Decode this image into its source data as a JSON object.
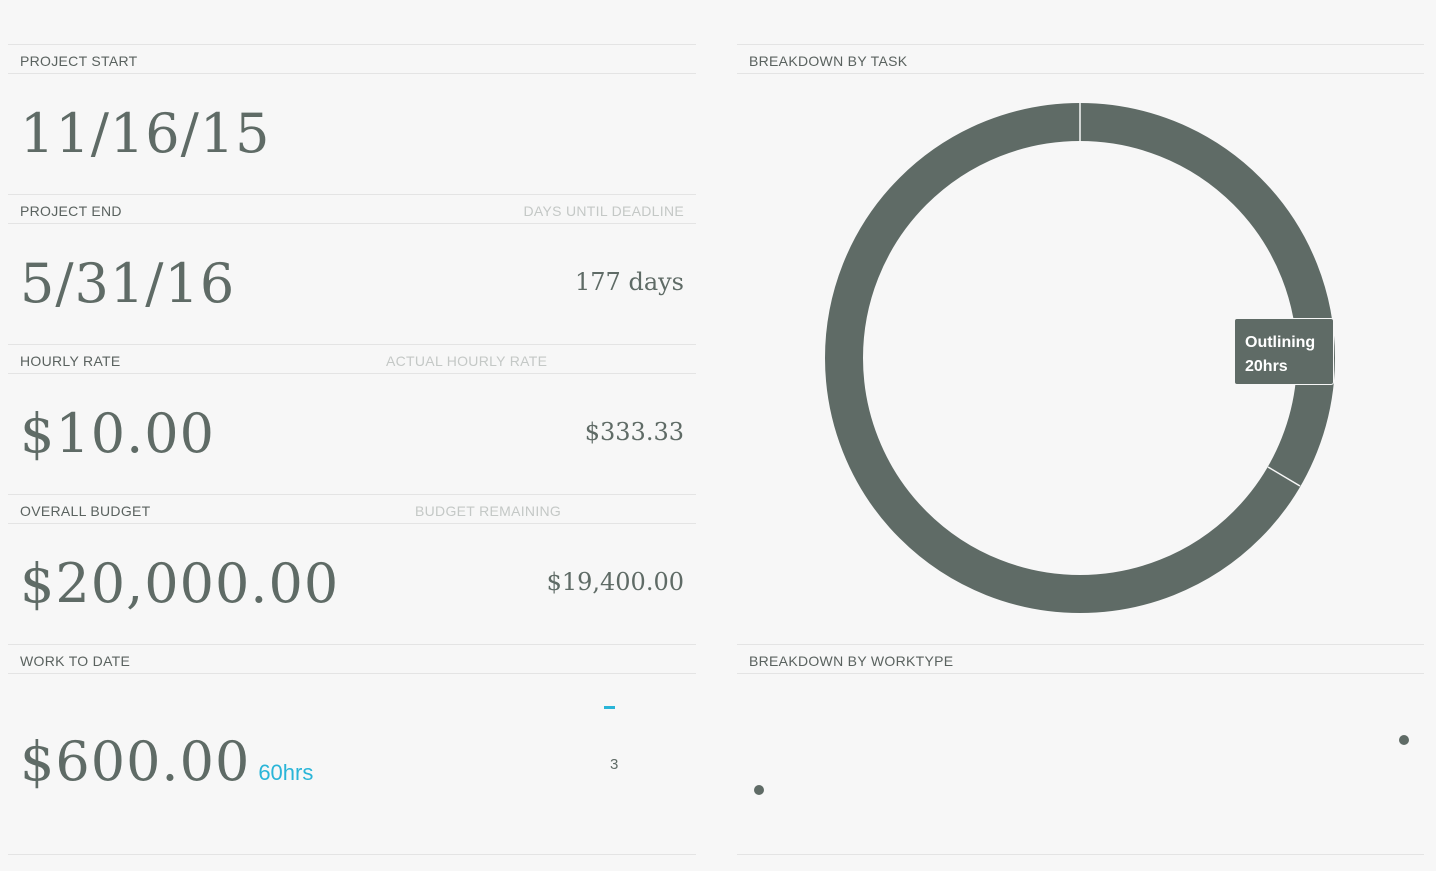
{
  "project_start": {
    "label": "PROJECT START",
    "value": "11/16/15"
  },
  "project_end": {
    "label": "PROJECT END",
    "sub_label": "DAYS UNTIL DEADLINE",
    "value": "5/31/16",
    "days": "177 days"
  },
  "hourly_rate": {
    "label": "HOURLY RATE",
    "sub_label": "ACTUAL HOURLY RATE",
    "value": "$10.00",
    "actual": "$333.33"
  },
  "overall_budget": {
    "label": "OVERALL BUDGET",
    "sub_label": "BUDGET REMAINING",
    "value": "$20,000.00",
    "remaining": "$19,400.00"
  },
  "work_to_date": {
    "label": "WORK TO DATE",
    "value": "$600.00",
    "hours": "60hrs",
    "mini_count": "3"
  },
  "breakdown_task": {
    "label": "BREAKDOWN BY TASK",
    "tooltip_task": "Outlining",
    "tooltip_hours": "20hrs"
  },
  "breakdown_worktype": {
    "label": "BREAKDOWN BY WORKTYPE"
  },
  "colors": {
    "accent": "#2ab5d8",
    "ring": "#5f6b66",
    "background": "#f7f7f7"
  }
}
